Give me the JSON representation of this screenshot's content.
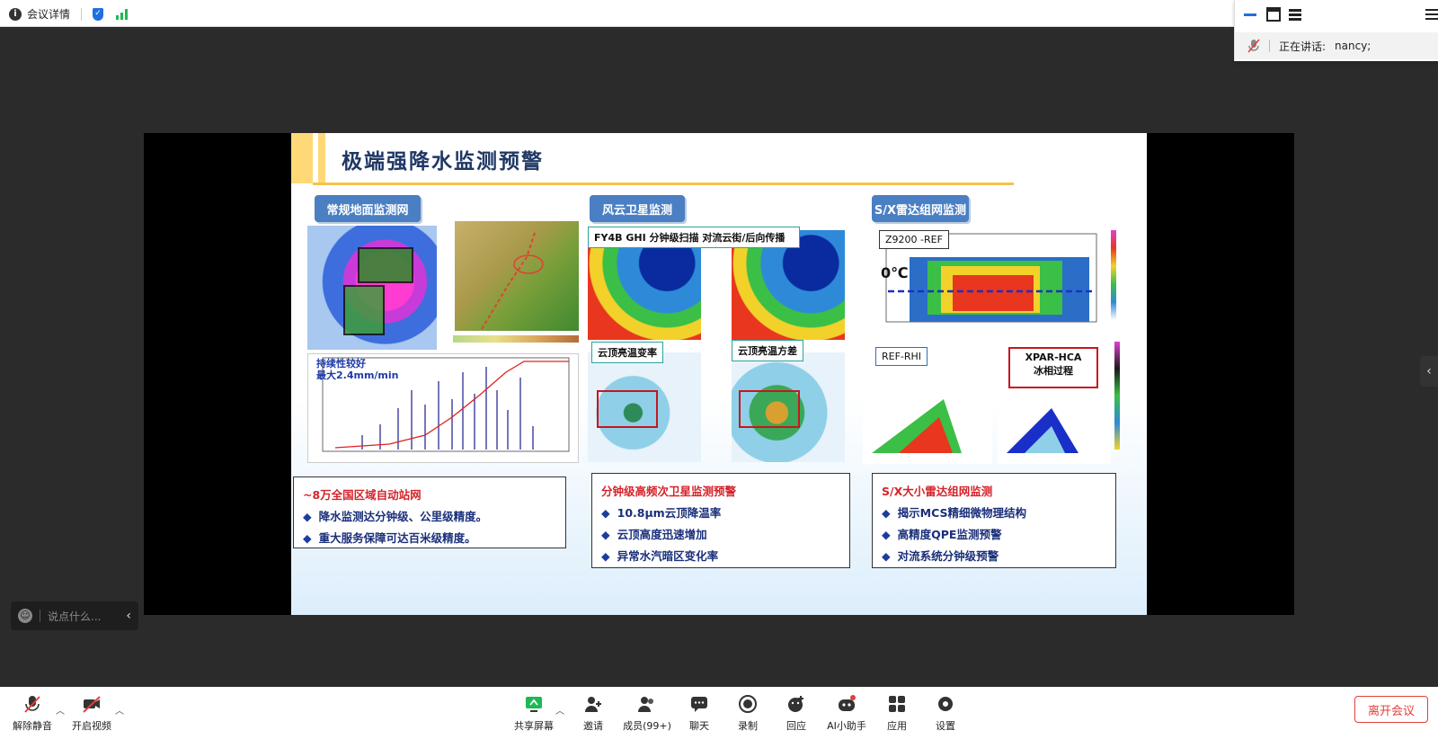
{
  "topbar": {
    "meeting_details": "会议详情"
  },
  "speaker_panel": {
    "label": "正在讲话:",
    "name": "nancy;"
  },
  "slide": {
    "title": "极端强降水监测预警",
    "sections": [
      {
        "tag": "常规地面监测网",
        "annotation": "持续性较好\n最大2.4mm/min",
        "box": {
          "heading": "~8万全国区域自动站网",
          "items": [
            "降水监测达分钟级、公里级精度。",
            "重大服务保障可达百米级精度。"
          ]
        }
      },
      {
        "tag": "风云卫星监测",
        "label1": "FY4B GHI 分钟级扫描 对流云街/后向传播",
        "label2": "云顶亮温变率",
        "label3": "云顶亮温方差",
        "box": {
          "heading": "分钟级高频次卫星监测预警",
          "items": [
            "10.8μm云顶降温率",
            "云顶高度迅速增加",
            "异常水汽暗区变化率"
          ]
        }
      },
      {
        "tag": "S/X雷达组网监测",
        "label1": "Z9200 -REF",
        "label2": "0℃",
        "label3": "REF-RHI",
        "label4": "XPAR-HCA\n冰相过程",
        "box": {
          "heading": "S/X大小雷达组网监测",
          "items": [
            "揭示MCS精细微物理结构",
            "高精度QPE监测预警",
            "对流系统分钟级预警"
          ]
        }
      }
    ]
  },
  "chat": {
    "placeholder": "说点什么..."
  },
  "toolbar": {
    "mute": "解除静音",
    "video": "开启视频",
    "share": "共享屏幕",
    "invite": "邀请",
    "members": "成员(99+)",
    "chat": "聊天",
    "record": "录制",
    "reaction": "回应",
    "ai": "AI小助手",
    "apps": "应用",
    "settings": "设置",
    "leave": "离开会议"
  },
  "colors": {
    "accent_green": "#1db954",
    "leave_red": "#e0403a",
    "tag_blue": "#4a7fc3"
  }
}
